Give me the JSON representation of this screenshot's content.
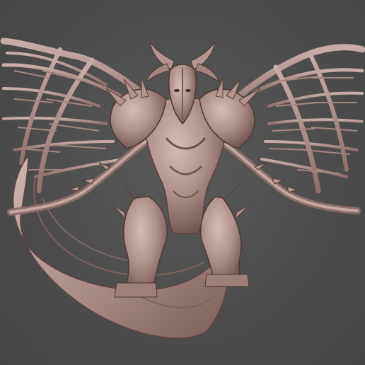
{
  "scene": {
    "subject": "sculpted-dragon-model-render",
    "colors": {
      "background": "#4f4f4f",
      "clay_light": "#c9b1ac",
      "clay_mid": "#a98a85",
      "clay_dark": "#6e524e",
      "clay_shadow": "#3f2f2d"
    }
  }
}
